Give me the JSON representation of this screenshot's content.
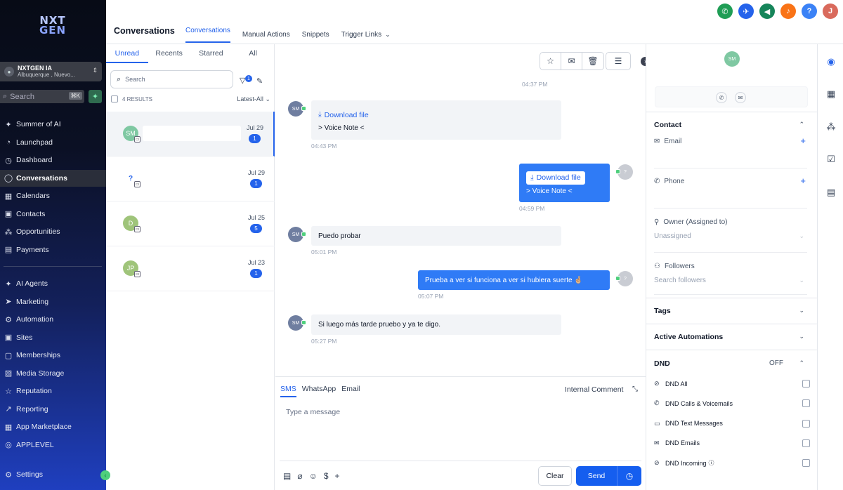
{
  "brand": {
    "line1": "NXT",
    "line2": "GEN"
  },
  "account": {
    "name": "NXTGEN IA",
    "location": "Albuquerque , Nuevo..."
  },
  "search": {
    "placeholder": "Search",
    "shortcut": "⌘K"
  },
  "nav": [
    {
      "label": "Summer of AI",
      "icon": "sparkles-icon",
      "glyph": "✦"
    },
    {
      "label": "Launchpad",
      "icon": "launchpad-icon",
      "glyph": "◔"
    },
    {
      "label": "Dashboard",
      "icon": "dashboard-icon",
      "glyph": "◷"
    },
    {
      "label": "Conversations",
      "icon": "chat-icon",
      "glyph": "◯",
      "active": true
    },
    {
      "label": "Calendars",
      "icon": "calendar-icon",
      "glyph": "▦"
    },
    {
      "label": "Contacts",
      "icon": "contacts-icon",
      "glyph": "▣"
    },
    {
      "label": "Opportunities",
      "icon": "opportunities-icon",
      "glyph": "⁂"
    },
    {
      "label": "Payments",
      "icon": "payments-icon",
      "glyph": "▤"
    }
  ],
  "nav2": [
    {
      "label": "AI Agents",
      "icon": "ai-agents-icon",
      "glyph": "✦"
    },
    {
      "label": "Marketing",
      "icon": "send-icon",
      "glyph": "➤"
    },
    {
      "label": "Automation",
      "icon": "automation-icon",
      "glyph": "⚙"
    },
    {
      "label": "Sites",
      "icon": "sites-icon",
      "glyph": "▣"
    },
    {
      "label": "Memberships",
      "icon": "memberships-icon",
      "glyph": "▢"
    },
    {
      "label": "Media Storage",
      "icon": "media-icon",
      "glyph": "▨"
    },
    {
      "label": "Reputation",
      "icon": "star-icon",
      "glyph": "☆"
    },
    {
      "label": "Reporting",
      "icon": "reporting-icon",
      "glyph": "↗"
    },
    {
      "label": "App Marketplace",
      "icon": "marketplace-icon",
      "glyph": "▦"
    },
    {
      "label": "APPLEVEL",
      "icon": "whatsapp-icon",
      "glyph": "◎"
    }
  ],
  "settings": {
    "label": "Settings"
  },
  "header": {
    "title": "Conversations",
    "tabs": [
      "Conversations",
      "Manual Actions",
      "Snippets",
      "Trigger Links"
    ]
  },
  "topicons": [
    {
      "name": "phone-icon",
      "glyph": "✆",
      "color": "#1f9d55"
    },
    {
      "name": "rocket-icon",
      "glyph": "✈",
      "color": "#2563eb"
    },
    {
      "name": "megaphone-icon",
      "glyph": "◀",
      "color": "#16855a"
    },
    {
      "name": "bell-icon",
      "glyph": "♪",
      "color": "#f97316"
    },
    {
      "name": "help-icon",
      "glyph": "?",
      "color": "#3b82f6"
    },
    {
      "name": "user-avatar-icon",
      "glyph": "J",
      "color": "#d96a5c"
    }
  ],
  "list": {
    "tabs": [
      "Unread",
      "Recents",
      "Starred",
      "All"
    ],
    "search_placeholder": "Search",
    "filter_badge": "1",
    "results": "4 RESULTS",
    "sort": "Latest-All",
    "items": [
      {
        "initials": "SM",
        "color": "#7fc8a2",
        "date": "Jul 29",
        "count": "1",
        "selected": true
      },
      {
        "initials": "?",
        "color": "#ffffff",
        "date": "Jul 29",
        "count": "1"
      },
      {
        "initials": "D",
        "color": "#9fc47a",
        "date": "Jul 25",
        "count": "5"
      },
      {
        "initials": "JP",
        "color": "#9fc47a",
        "date": "Jul 23",
        "count": "1"
      }
    ]
  },
  "chat": {
    "top_time": "04:37 PM",
    "messages": [
      {
        "dir": "in",
        "avatar": "SM",
        "download": "Download file",
        "text": "> Voice Note <",
        "time": "04:43 PM"
      },
      {
        "dir": "out",
        "avatar": "?",
        "download": "Download file",
        "text": "> Voice Note <",
        "time": "04:59 PM"
      },
      {
        "dir": "in",
        "avatar": "SM",
        "text": "Puedo probar",
        "time": "05:01 PM"
      },
      {
        "dir": "out",
        "avatar": "?",
        "text": "Prueba a ver si funciona a ver si hubiera suerte 🤞🏼",
        "time": "05:07 PM"
      },
      {
        "dir": "in",
        "avatar": "SM",
        "text": "Si luego más tarde pruebo y ya te digo.",
        "time": "05:27 PM"
      }
    ]
  },
  "composer": {
    "tabs": [
      "SMS",
      "WhatsApp",
      "Email"
    ],
    "internal": "Internal Comment",
    "placeholder": "Type a message",
    "clear": "Clear",
    "send": "Send"
  },
  "contact": {
    "avatar": "SM",
    "section": "Contact",
    "email_label": "Email",
    "phone_label": "Phone",
    "owner_label": "Owner (Assigned to)",
    "owner_value": "Unassigned",
    "followers_label": "Followers",
    "followers_placeholder": "Search followers",
    "tags": "Tags",
    "automations": "Active Automations",
    "dnd": "DND",
    "dnd_state": "OFF",
    "dnd_items": [
      "DND All",
      "DND Calls & Voicemails",
      "DND Text Messages",
      "DND Emails",
      "DND Incoming"
    ]
  }
}
